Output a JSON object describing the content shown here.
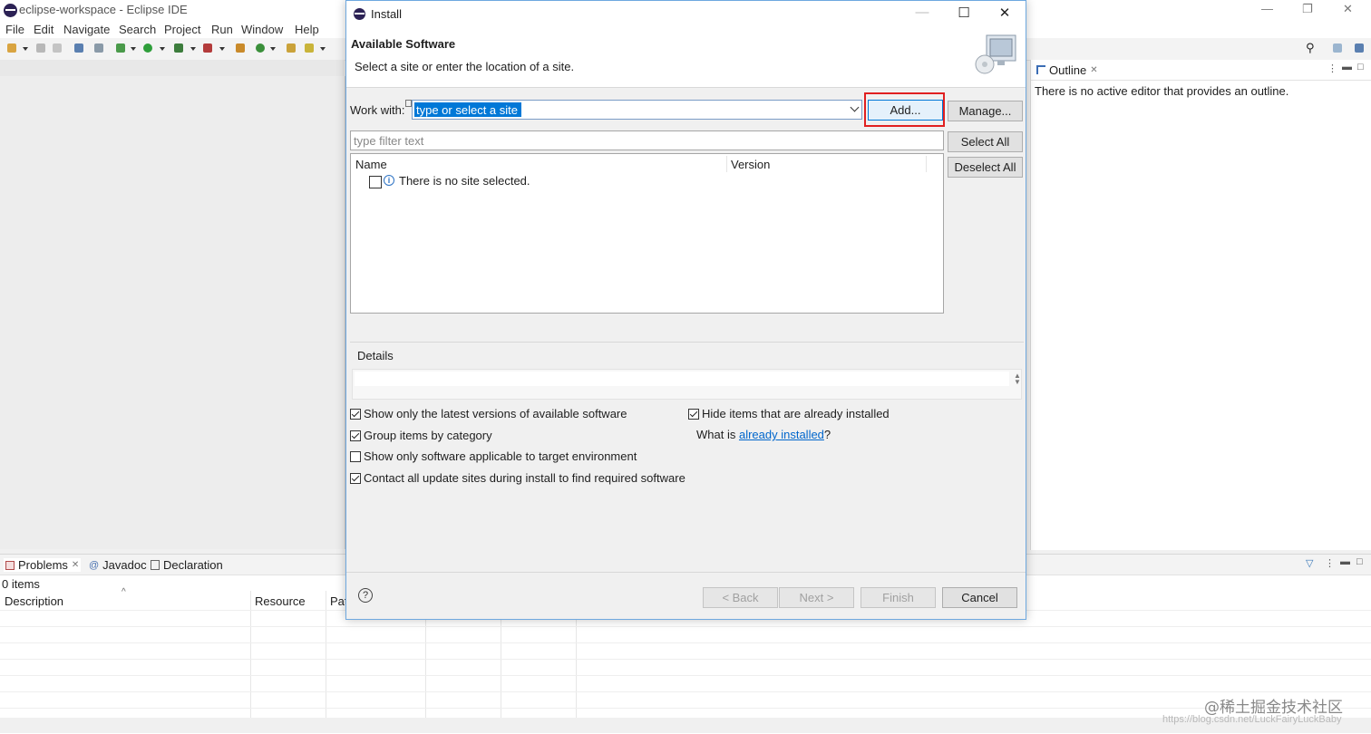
{
  "ide": {
    "title": "eclipse-workspace - Eclipse IDE",
    "menu": [
      "File",
      "Edit",
      "Navigate",
      "Search",
      "Project",
      "Run",
      "Window",
      "Help"
    ],
    "outline": {
      "tab_label": "Outline",
      "message": "There is no active editor that provides an outline."
    },
    "bottom_tabs": {
      "problems": "Problems",
      "javadoc": "Javadoc",
      "declaration": "Declaration"
    },
    "problems": {
      "count": "0 items",
      "columns": [
        "Description",
        "Resource",
        "Pat"
      ]
    },
    "watermark": "@稀土掘金技术社区",
    "watermark_url": "https://blog.csdn.net/LuckFairyLuckBaby"
  },
  "dialog": {
    "title": "Install",
    "header_title": "Available Software",
    "header_subtitle": "Select a site or enter the location of a site.",
    "work_with_label": "Work with:",
    "work_with_value": "type or select a site",
    "buttons": {
      "add": "Add...",
      "manage": "Manage...",
      "select_all": "Select All",
      "deselect_all": "Deselect All",
      "back": "< Back",
      "next": "Next >",
      "finish": "Finish",
      "cancel": "Cancel"
    },
    "filter_placeholder": "type filter text",
    "table": {
      "columns": [
        "Name",
        "Version"
      ],
      "empty_message": "There is no site selected."
    },
    "details_label": "Details",
    "options": {
      "latest_versions": {
        "label": "Show only the latest versions of available software",
        "checked": true
      },
      "hide_installed": {
        "label": "Hide items that are already installed",
        "checked": true
      },
      "group_by_category": {
        "label": "Group items by category",
        "checked": true
      },
      "target_env": {
        "label": "Show only software applicable to target environment",
        "checked": false
      },
      "contact_sites": {
        "label": "Contact all update sites during install to find required software",
        "checked": true
      }
    },
    "what_is_prefix": "What is ",
    "already_installed_link": "already installed",
    "what_is_suffix": "?",
    "help_symbol": "?"
  },
  "colors": {
    "selection": "#0078d7",
    "highlight_box": "#e02020",
    "link": "#0066cc"
  }
}
